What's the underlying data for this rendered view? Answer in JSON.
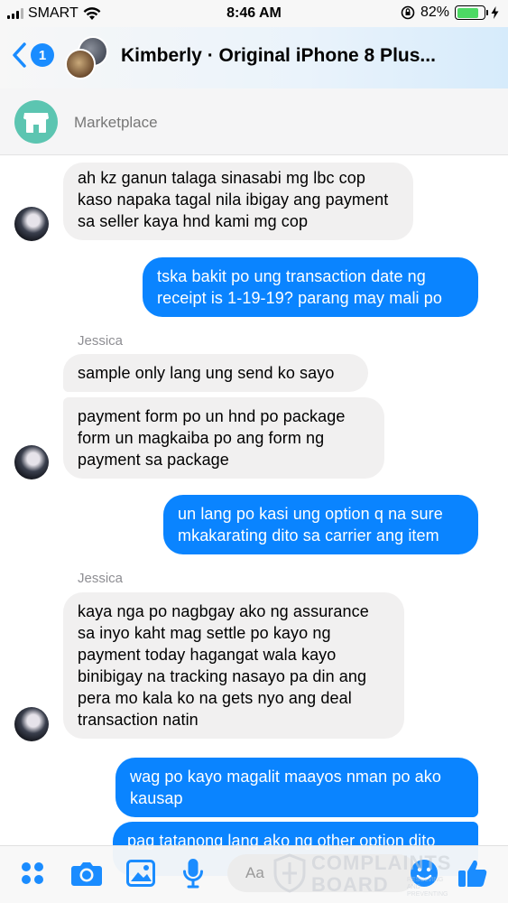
{
  "status_bar": {
    "carrier": "SMART",
    "time": "8:46 AM",
    "battery_percent": "82%",
    "battery_level": 0.82
  },
  "header": {
    "back_badge": "1",
    "title": "Kimberly · Original iPhone 8 Plus..."
  },
  "marketplace": {
    "label": "Marketplace"
  },
  "messages": [
    {
      "direction": "in",
      "text": "ah kz ganun talaga sinasabi mg lbc cop kaso napaka tagal nila ibigay ang payment sa seller kaya hnd kami mg cop"
    },
    {
      "direction": "out",
      "text": "tska bakit po ung transaction date ng receipt is 1-19-19? parang may mali po"
    },
    {
      "direction": "in",
      "sender": "Jessica",
      "text": "sample only lang ung send ko sayo"
    },
    {
      "direction": "in",
      "text": "payment form po un hnd po package form un magkaiba po ang form ng payment sa package"
    },
    {
      "direction": "out",
      "text": "un lang po kasi ung option q na sure mkakarating dito sa carrier ang item"
    },
    {
      "direction": "in",
      "sender": "Jessica",
      "text": "kaya nga po nagbgay ako ng assurance sa inyo kaht mag settle po kayo ng payment today hagangat wala kayo binibigay na tracking nasayo pa din ang pera mo kala ko na gets nyo ang deal transaction natin"
    },
    {
      "direction": "out",
      "text": "wag po kayo magalit maayos nman po ako kausap"
    },
    {
      "direction": "out",
      "text": "pag tatanong lang ako ng other option dito"
    }
  ],
  "composer": {
    "placeholder": "Aa"
  },
  "watermark": {
    "line1": "COMPLAINTS",
    "line2": "BOARD",
    "small": "RESOLVING AND PREVENTING"
  },
  "colors": {
    "outgoing_bubble": "#0a84ff",
    "incoming_bubble": "#f1f0f0",
    "accent": "#1a8cff",
    "marketplace_icon": "#5cc5b1"
  }
}
